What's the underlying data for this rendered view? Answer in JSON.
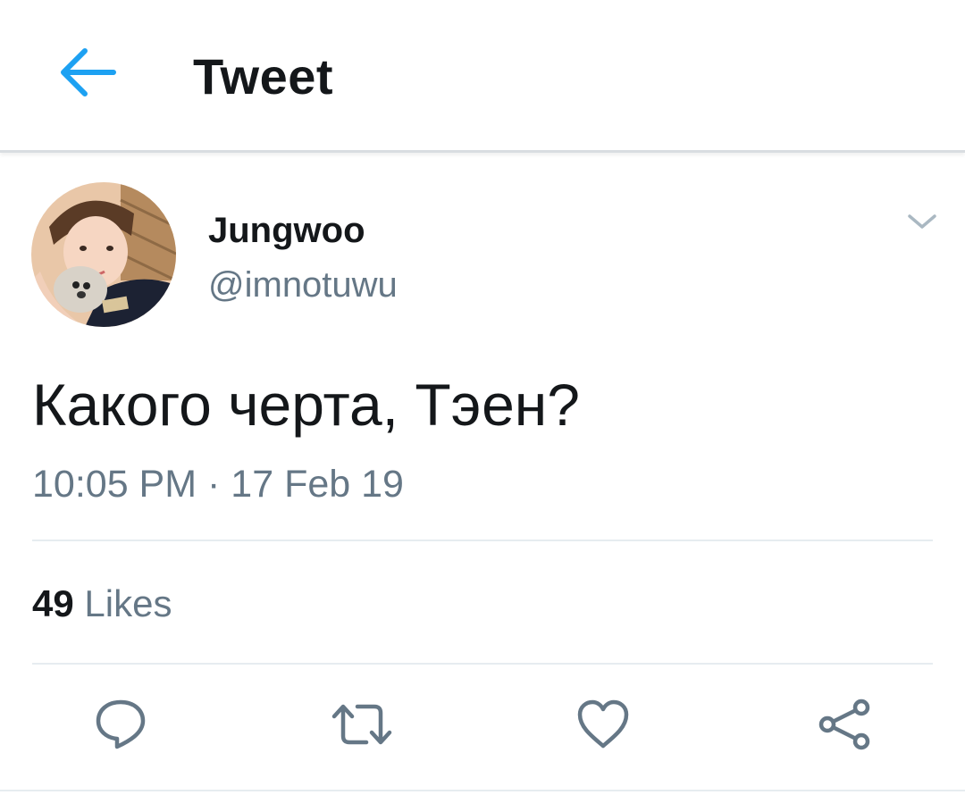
{
  "header": {
    "title": "Tweet",
    "back_icon": "arrow-left-icon",
    "accent_color": "#1da1f2"
  },
  "tweet": {
    "display_name": "Jungwoo",
    "username": "@imnotuwu",
    "text": "Какого черта, Тэен?",
    "time": "10:05 PM",
    "separator": "·",
    "date": "17 Feb 19",
    "likes_count": "49",
    "likes_label": "Likes",
    "menu_icon": "chevron-down-icon"
  },
  "actions": [
    {
      "name": "reply",
      "icon": "comment-bubble-icon"
    },
    {
      "name": "retweet",
      "icon": "retweet-icon"
    },
    {
      "name": "like",
      "icon": "heart-icon"
    },
    {
      "name": "share",
      "icon": "share-icon"
    }
  ],
  "colors": {
    "text_primary": "#14171a",
    "text_secondary": "#657786",
    "divider": "#e6ecf0"
  }
}
